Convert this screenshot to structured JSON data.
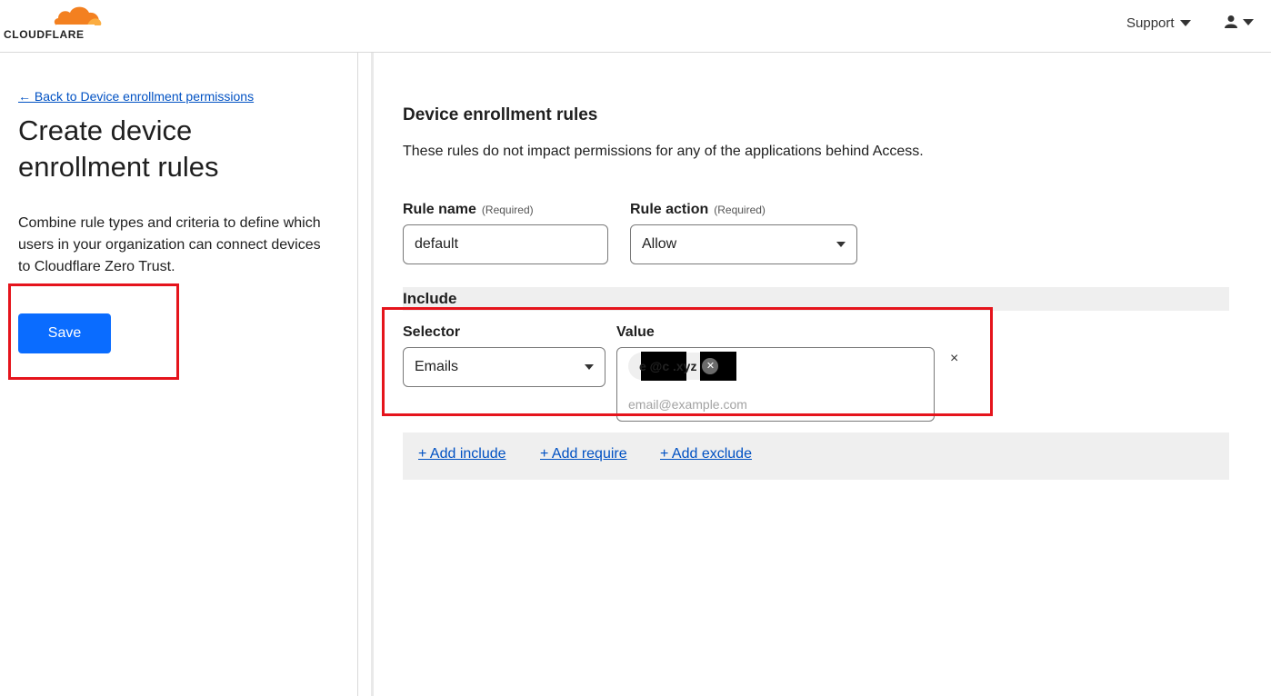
{
  "header": {
    "logo_text": "CLOUDFLARE",
    "support_label": "Support",
    "brand_orange": "#f38020"
  },
  "sidebar": {
    "back_link": "← Back to Device enrollment permissions",
    "title": "Create device enrollment rules",
    "description": "Combine rule types and criteria to define which users in your organization can connect devices to Cloudflare Zero Trust.",
    "save_label": "Save"
  },
  "form": {
    "section_title": "Device enrollment rules",
    "section_description": "These rules do not impact permissions for any of the applications behind Access.",
    "rule_name_label": "Rule name",
    "rule_action_label": "Rule action",
    "required_text": "(Required)",
    "rule_name_value": "default",
    "rule_action_value": "Allow",
    "include_label": "Include",
    "selector_label": "Selector",
    "value_label": "Value",
    "selector_value": "Emails",
    "email_chip_visible": "e     @c     .xyz",
    "value_placeholder": "email@example.com",
    "remove_rule_glyph": "×",
    "add_include": "+ Add include",
    "add_require": "+ Add require",
    "add_exclude": "+ Add exclude"
  },
  "colors": {
    "primary_button": "#0a6cff",
    "link": "#0051c3",
    "highlight": "#e5141c"
  }
}
